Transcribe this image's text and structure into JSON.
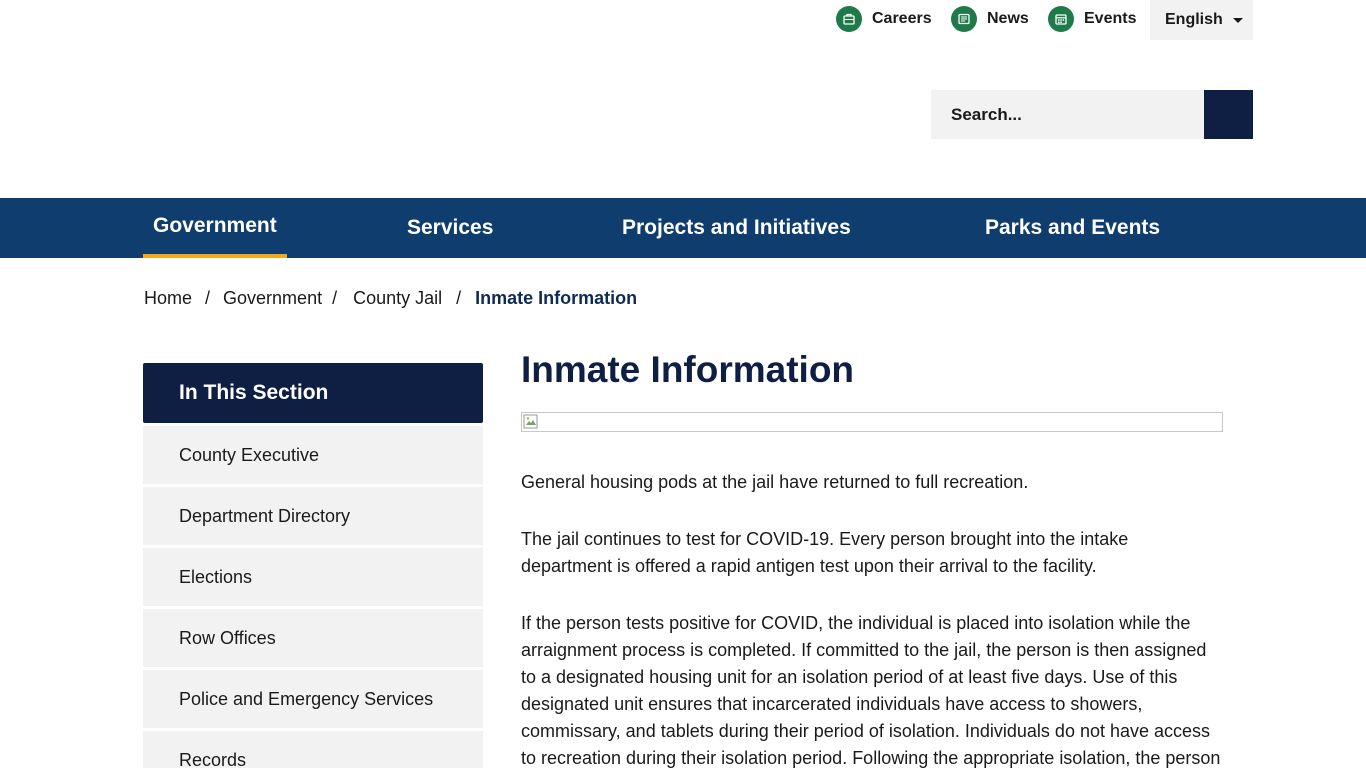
{
  "utility": {
    "careers": "Careers",
    "news": "News",
    "events": "Events",
    "language": "English"
  },
  "search": {
    "placeholder": "Search..."
  },
  "nav": {
    "items": [
      {
        "label": "Government"
      },
      {
        "label": "Services"
      },
      {
        "label": "Projects and Initiatives"
      },
      {
        "label": "Parks and Events"
      }
    ]
  },
  "breadcrumb": {
    "home": "Home",
    "government": "Government",
    "county_jail": "County Jail",
    "current": "Inmate Information"
  },
  "sidebar": {
    "heading": "In This Section",
    "items": [
      {
        "label": "County Executive"
      },
      {
        "label": "Department Directory"
      },
      {
        "label": "Elections"
      },
      {
        "label": "Row Offices"
      },
      {
        "label": "Police and Emergency Services"
      },
      {
        "label": "Records"
      }
    ]
  },
  "main": {
    "title": "Inmate Information",
    "paragraphs": [
      "General housing pods at the jail have returned to full recreation.",
      "The jail continues to test for COVID-19. Every person brought into the intake department is offered a rapid antigen test upon their arrival to the facility.",
      "If the person tests positive for COVID, the individual is placed into isolation while the arraignment process is completed. If committed to the jail, the person is then assigned to a designated housing unit for an isolation period of at least five days. Use of this designated unit ensures that incarcerated individuals have access to showers, commissary, and tablets during their period of isolation. Individuals do not have access to recreation during their isolation period. Following the appropriate isolation, the person"
    ]
  },
  "colors": {
    "nav_bg": "#0f3d6e",
    "dark_navy": "#0f1f44",
    "accent_underline": "#f0a81c",
    "icon_green": "#1f7a4a",
    "light_gray": "#f2f2f2"
  }
}
